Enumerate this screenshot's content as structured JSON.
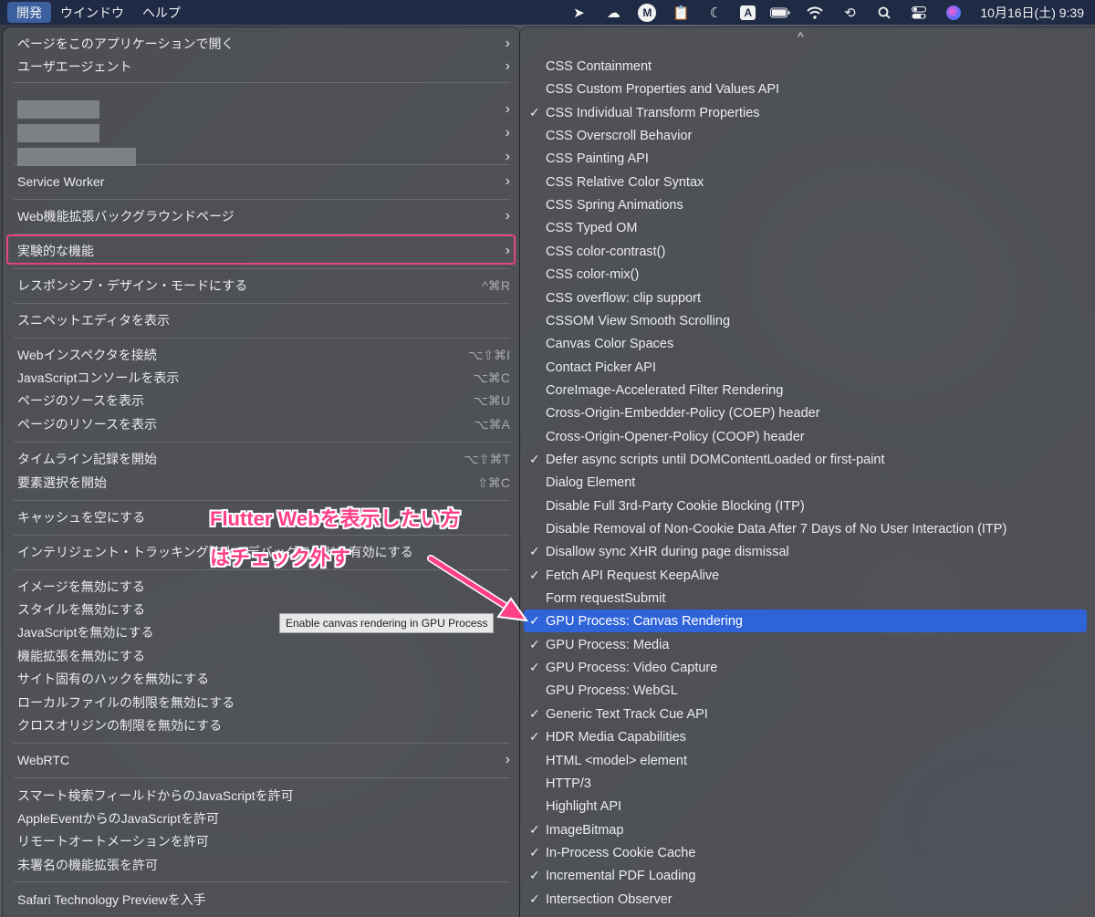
{
  "menubar": {
    "items": [
      "開発",
      "ウインドウ",
      "ヘルプ"
    ],
    "clock": "10月16日(土)  9:39",
    "icons": [
      "airplane-arrow-icon",
      "cloud-sync-icon",
      "m-logo-icon",
      "clipboard-icon",
      "moon-icon",
      "input-a-icon",
      "battery-icon",
      "wifi-icon",
      "time-machine-icon",
      "search-icon",
      "control-center-icon",
      "siri-icon"
    ],
    "icon_text": {
      "m": "M",
      "a": "A"
    }
  },
  "left_menu": {
    "items": [
      {
        "label": "ページをこのアプリケーションで開く",
        "chevron": true
      },
      {
        "label": "ユーザエージェント",
        "chevron": true
      },
      {
        "label": "Service Worker",
        "chevron": true
      },
      {
        "label": "Web機能拡張バックグラウンドページ",
        "chevron": true
      },
      {
        "label": "実験的な機能",
        "chevron": true
      },
      {
        "label": "レスポンシブ・デザイン・モードにする",
        "shortcut": "^⌘R"
      },
      {
        "label": "スニペットエディタを表示"
      },
      {
        "label": "Webインスペクタを接続",
        "shortcut": "⌥⇧⌘I"
      },
      {
        "label": "JavaScriptコンソールを表示",
        "shortcut": "⌥⌘C"
      },
      {
        "label": "ページのソースを表示",
        "shortcut": "⌥⌘U"
      },
      {
        "label": "ページのリソースを表示",
        "shortcut": "⌥⌘A"
      },
      {
        "label": "タイムライン記録を開始",
        "shortcut": "⌥⇧⌘T"
      },
      {
        "label": "要素選択を開始",
        "shortcut": "⇧⌘C"
      },
      {
        "label": "キャッシュを空にする"
      },
      {
        "label": "インテリジェント・トラッキング防止のデバッグモードを有効にする"
      },
      {
        "label": "イメージを無効にする"
      },
      {
        "label": "スタイルを無効にする"
      },
      {
        "label": "JavaScriptを無効にする"
      },
      {
        "label": "機能拡張を無効にする"
      },
      {
        "label": "サイト固有のハックを無効にする"
      },
      {
        "label": "ローカルファイルの制限を無効にする"
      },
      {
        "label": "クロスオリジンの制限を無効にする"
      },
      {
        "label": "WebRTC",
        "chevron": true
      },
      {
        "label": "スマート検索フィールドからのJavaScriptを許可"
      },
      {
        "label": "AppleEventからのJavaScriptを許可"
      },
      {
        "label": "リモートオートメーションを許可"
      },
      {
        "label": "未署名の機能拡張を許可"
      },
      {
        "label": "Safari Technology Previewを入手"
      }
    ]
  },
  "right_menu": {
    "scroll_indicator": "^",
    "items": [
      {
        "label": "CSS Containment",
        "checked": false
      },
      {
        "label": "CSS Custom Properties and Values API",
        "checked": false
      },
      {
        "label": "CSS Individual Transform Properties",
        "checked": true
      },
      {
        "label": "CSS Overscroll Behavior",
        "checked": false
      },
      {
        "label": "CSS Painting API",
        "checked": false
      },
      {
        "label": "CSS Relative Color Syntax",
        "checked": false
      },
      {
        "label": "CSS Spring Animations",
        "checked": false
      },
      {
        "label": "CSS Typed OM",
        "checked": false
      },
      {
        "label": "CSS color-contrast()",
        "checked": false
      },
      {
        "label": "CSS color-mix()",
        "checked": false
      },
      {
        "label": "CSS overflow: clip support",
        "checked": false
      },
      {
        "label": "CSSOM View Smooth Scrolling",
        "checked": false
      },
      {
        "label": "Canvas Color Spaces",
        "checked": false
      },
      {
        "label": "Contact Picker API",
        "checked": false
      },
      {
        "label": "CoreImage-Accelerated Filter Rendering",
        "checked": false
      },
      {
        "label": "Cross-Origin-Embedder-Policy (COEP) header",
        "checked": false
      },
      {
        "label": "Cross-Origin-Opener-Policy (COOP) header",
        "checked": false
      },
      {
        "label": "Defer async scripts until DOMContentLoaded or first-paint",
        "checked": true
      },
      {
        "label": "Dialog Element",
        "checked": false
      },
      {
        "label": "Disable Full 3rd-Party Cookie Blocking (ITP)",
        "checked": false
      },
      {
        "label": "Disable Removal of Non-Cookie Data After 7 Days of No User Interaction (ITP)",
        "checked": false
      },
      {
        "label": "Disallow sync XHR during page dismissal",
        "checked": true
      },
      {
        "label": "Fetch API Request KeepAlive",
        "checked": true
      },
      {
        "label": "Form requestSubmit",
        "checked": false
      },
      {
        "label": "GPU Process: Canvas Rendering",
        "checked": true,
        "selected": true
      },
      {
        "label": "GPU Process: Media",
        "checked": true
      },
      {
        "label": "GPU Process: Video Capture",
        "checked": true
      },
      {
        "label": "GPU Process: WebGL",
        "checked": false
      },
      {
        "label": "Generic Text Track Cue API",
        "checked": true
      },
      {
        "label": "HDR Media Capabilities",
        "checked": true
      },
      {
        "label": "HTML <model> element",
        "checked": false
      },
      {
        "label": "HTTP/3",
        "checked": false
      },
      {
        "label": "Highlight API",
        "checked": false
      },
      {
        "label": "ImageBitmap",
        "checked": true
      },
      {
        "label": "In-Process Cookie Cache",
        "checked": true
      },
      {
        "label": "Incremental PDF Loading",
        "checked": true
      },
      {
        "label": "Intersection Observer",
        "checked": true
      }
    ]
  },
  "tooltip": "Enable canvas rendering in GPU Process",
  "annotation": {
    "line1": "Flutter Webを表示したい方",
    "line2": "はチェック外す",
    "color": "#ff3f86"
  },
  "selection_color": "#2f63d8",
  "highlight_color": "#e7457a",
  "check_glyph": "✓",
  "chevron_glyph": "›"
}
